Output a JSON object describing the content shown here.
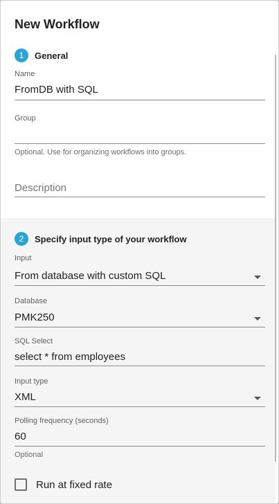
{
  "dialog": {
    "title": "New Workflow"
  },
  "general": {
    "step_number": "1",
    "step_title": "General",
    "name": {
      "label": "Name",
      "value": "FromDB with SQL"
    },
    "group": {
      "label": "Group",
      "value": "",
      "hint": "Optional. Use for organizing workflows into groups."
    },
    "description": {
      "placeholder": "Description",
      "value": ""
    }
  },
  "input_section": {
    "step_number": "2",
    "step_title": "Specify input type of your workflow",
    "input": {
      "label": "Input",
      "value": "From database with custom SQL"
    },
    "database": {
      "label": "Database",
      "value": "PMK250"
    },
    "sql_select": {
      "label": "SQL Select",
      "value": "select * from employees"
    },
    "input_type": {
      "label": "Input type",
      "value": "XML"
    },
    "polling": {
      "label": "Polling frequency (seconds)",
      "value": "60",
      "hint": "Optional"
    },
    "fixed_rate": {
      "label": "Run at fixed rate",
      "checked": false
    }
  },
  "colors": {
    "accent": "#2aa4d5",
    "section_bg": "#f5f5f5"
  }
}
